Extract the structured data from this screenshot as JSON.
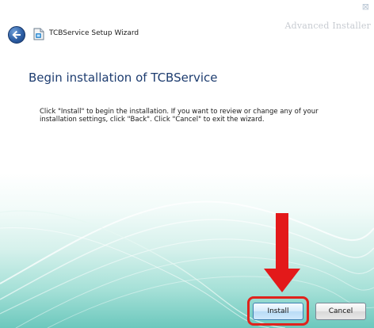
{
  "window": {
    "watermark": "Advanced Installer",
    "close_glyph": "⊠"
  },
  "header": {
    "back_icon": "back-arrow-icon",
    "app_icon": "setup-package-icon",
    "wizard_title": "TCBService Setup Wizard"
  },
  "main": {
    "title": "Begin installation of TCBService",
    "description": "Click \"Install\" to begin the installation.  If you want to review or change any of your installation settings, click \"Back\".  Click \"Cancel\" to exit the wizard."
  },
  "buttons": {
    "install": "Install",
    "cancel": "Cancel"
  },
  "annotation": {
    "arrow_color": "#e3191a",
    "highlight_color": "#e0231c"
  },
  "colors": {
    "title_blue": "#1e3d70",
    "teal_background": "#6cc8bd"
  }
}
